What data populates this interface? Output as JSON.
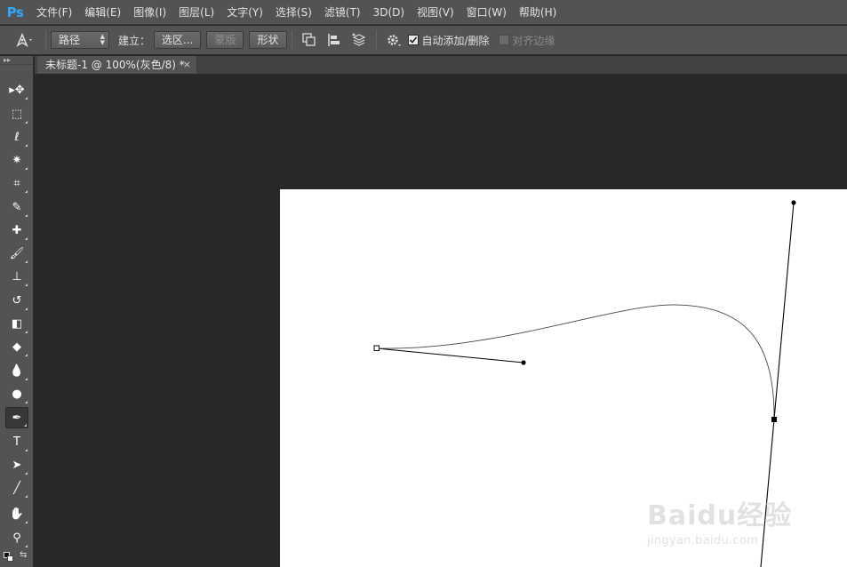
{
  "app": {
    "logo": "Ps"
  },
  "menu": [
    "文件(F)",
    "编辑(E)",
    "图像(I)",
    "图层(L)",
    "文字(Y)",
    "选择(S)",
    "滤镜(T)",
    "3D(D)",
    "视图(V)",
    "窗口(W)",
    "帮助(H)"
  ],
  "options": {
    "mode_value": "路径",
    "make_label": "建立：",
    "selection_btn": "选区...",
    "mask_btn": "蒙版",
    "shape_btn": "形状",
    "auto_add_delete": {
      "label": "自动添加/删除",
      "checked": true
    },
    "align_edges": {
      "label": "对齐边缘",
      "checked": false,
      "disabled": true
    }
  },
  "document": {
    "tab_title": "未标题-1 @ 100%(灰色/8) *",
    "close_glyph": "×"
  },
  "tools": [
    {
      "name": "move-tool",
      "glyph": "▸✥"
    },
    {
      "name": "marquee-tool",
      "glyph": "⬚"
    },
    {
      "name": "lasso-tool",
      "glyph": "ℓ"
    },
    {
      "name": "magic-wand-tool",
      "glyph": "✷"
    },
    {
      "name": "crop-tool",
      "glyph": "⌗"
    },
    {
      "name": "eyedropper-tool",
      "glyph": "✎"
    },
    {
      "name": "healing-brush-tool",
      "glyph": "✚"
    },
    {
      "name": "brush-tool",
      "glyph": "🖌"
    },
    {
      "name": "stamp-tool",
      "glyph": "⊥"
    },
    {
      "name": "history-brush-tool",
      "glyph": "↺"
    },
    {
      "name": "eraser-tool",
      "glyph": "◧"
    },
    {
      "name": "paint-bucket-tool",
      "glyph": "◆"
    },
    {
      "name": "blur-tool",
      "glyph": "💧"
    },
    {
      "name": "dodge-tool",
      "glyph": "●"
    },
    {
      "name": "pen-tool",
      "glyph": "✒"
    },
    {
      "name": "type-tool",
      "glyph": "T"
    },
    {
      "name": "path-selection-tool",
      "glyph": "➤"
    },
    {
      "name": "line-tool",
      "glyph": "╱"
    },
    {
      "name": "hand-tool",
      "glyph": "✋"
    },
    {
      "name": "zoom-tool",
      "glyph": "⚲"
    }
  ],
  "active_tool": "pen-tool",
  "watermark": {
    "main": "Baidu经验",
    "sub": "jingyan.baidu.com"
  },
  "colors": {
    "chrome": "#535353",
    "workspace": "#282828",
    "canvas": "#ffffff",
    "logo": "#2ea7ff"
  }
}
